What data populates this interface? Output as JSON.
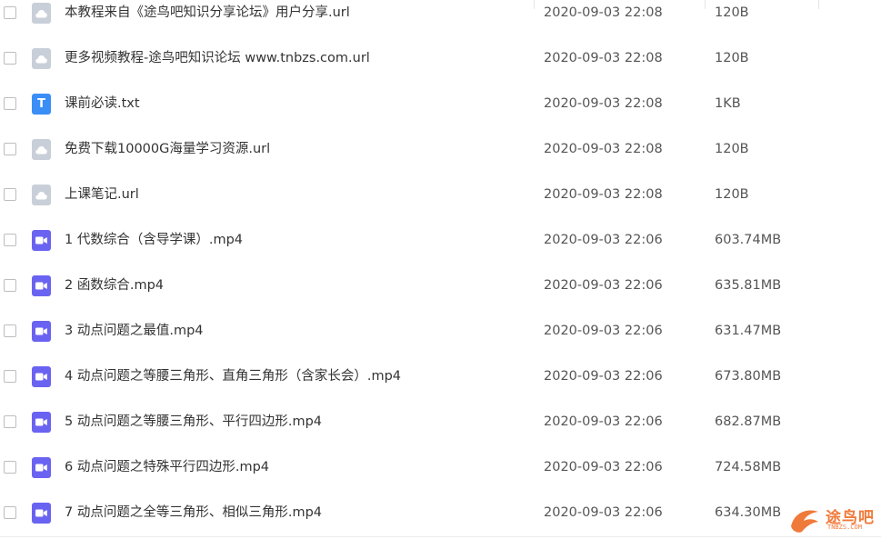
{
  "files": [
    {
      "name": "本教程来自《途鸟吧知识分享论坛》用户分享.url",
      "date": "2020-09-03 22:08",
      "size": "120B",
      "type": "url"
    },
    {
      "name": "更多视频教程-途鸟吧知识论坛 www.tnbzs.com.url",
      "date": "2020-09-03 22:08",
      "size": "120B",
      "type": "url"
    },
    {
      "name": "课前必读.txt",
      "date": "2020-09-03 22:08",
      "size": "1KB",
      "type": "txt"
    },
    {
      "name": "免费下载10000G海量学习资源.url",
      "date": "2020-09-03 22:08",
      "size": "120B",
      "type": "url"
    },
    {
      "name": "上课笔记.url",
      "date": "2020-09-03 22:08",
      "size": "120B",
      "type": "url"
    },
    {
      "name": "1 代数综合（含导学课）.mp4",
      "date": "2020-09-03 22:06",
      "size": "603.74MB",
      "type": "video"
    },
    {
      "name": "2 函数综合.mp4",
      "date": "2020-09-03 22:06",
      "size": "635.81MB",
      "type": "video"
    },
    {
      "name": "3 动点问题之最值.mp4",
      "date": "2020-09-03 22:06",
      "size": "631.47MB",
      "type": "video"
    },
    {
      "name": "4 动点问题之等腰三角形、直角三角形（含家长会）.mp4",
      "date": "2020-09-03 22:06",
      "size": "673.80MB",
      "type": "video"
    },
    {
      "name": "5 动点问题之等腰三角形、平行四边形.mp4",
      "date": "2020-09-03 22:06",
      "size": "682.87MB",
      "type": "video"
    },
    {
      "name": "6 动点问题之特殊平行四边形.mp4",
      "date": "2020-09-03 22:06",
      "size": "724.58MB",
      "type": "video"
    },
    {
      "name": "7 动点问题之全等三角形、相似三角形.mp4",
      "date": "2020-09-03 22:06",
      "size": "634.30MB",
      "type": "video"
    }
  ],
  "icons": {
    "url": "cloud-link-icon",
    "txt": "text-file-icon",
    "video": "video-file-icon"
  },
  "icon_letters": {
    "txt": "T"
  },
  "colors": {
    "url_icon": "#c9cfd8",
    "txt_icon": "#3a8ef6",
    "video_icon": "#6a63f2",
    "watermark": "#f07a3a"
  },
  "watermark": {
    "title": "途鸟吧",
    "sub": "TNBZS.COM"
  }
}
